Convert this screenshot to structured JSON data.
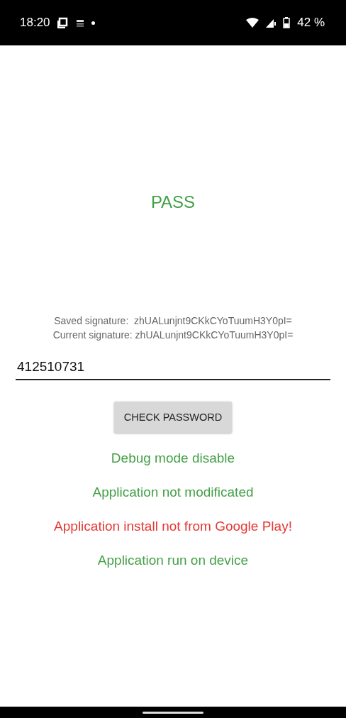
{
  "status_bar": {
    "time": "18:20",
    "battery": "42 %"
  },
  "result": {
    "text": "PASS",
    "color": "#43a047"
  },
  "signatures": [
    "Saved signature:  zhUALunjnt9CKkCYoTuumH3Y0pI=",
    "Current signature: zhUALunjnt9CKkCYoTuumH3Y0pI="
  ],
  "password_field": {
    "value": "412510731"
  },
  "check_button": {
    "label": "CHECK PASSWORD"
  },
  "checks": [
    {
      "text": "Debug mode disable",
      "color": "#43a047"
    },
    {
      "text": "Application not modificated",
      "color": "#43a047"
    },
    {
      "text": "Application install not from Google Play!",
      "color": "#e53935"
    },
    {
      "text": "Application run on device",
      "color": "#43a047"
    }
  ]
}
